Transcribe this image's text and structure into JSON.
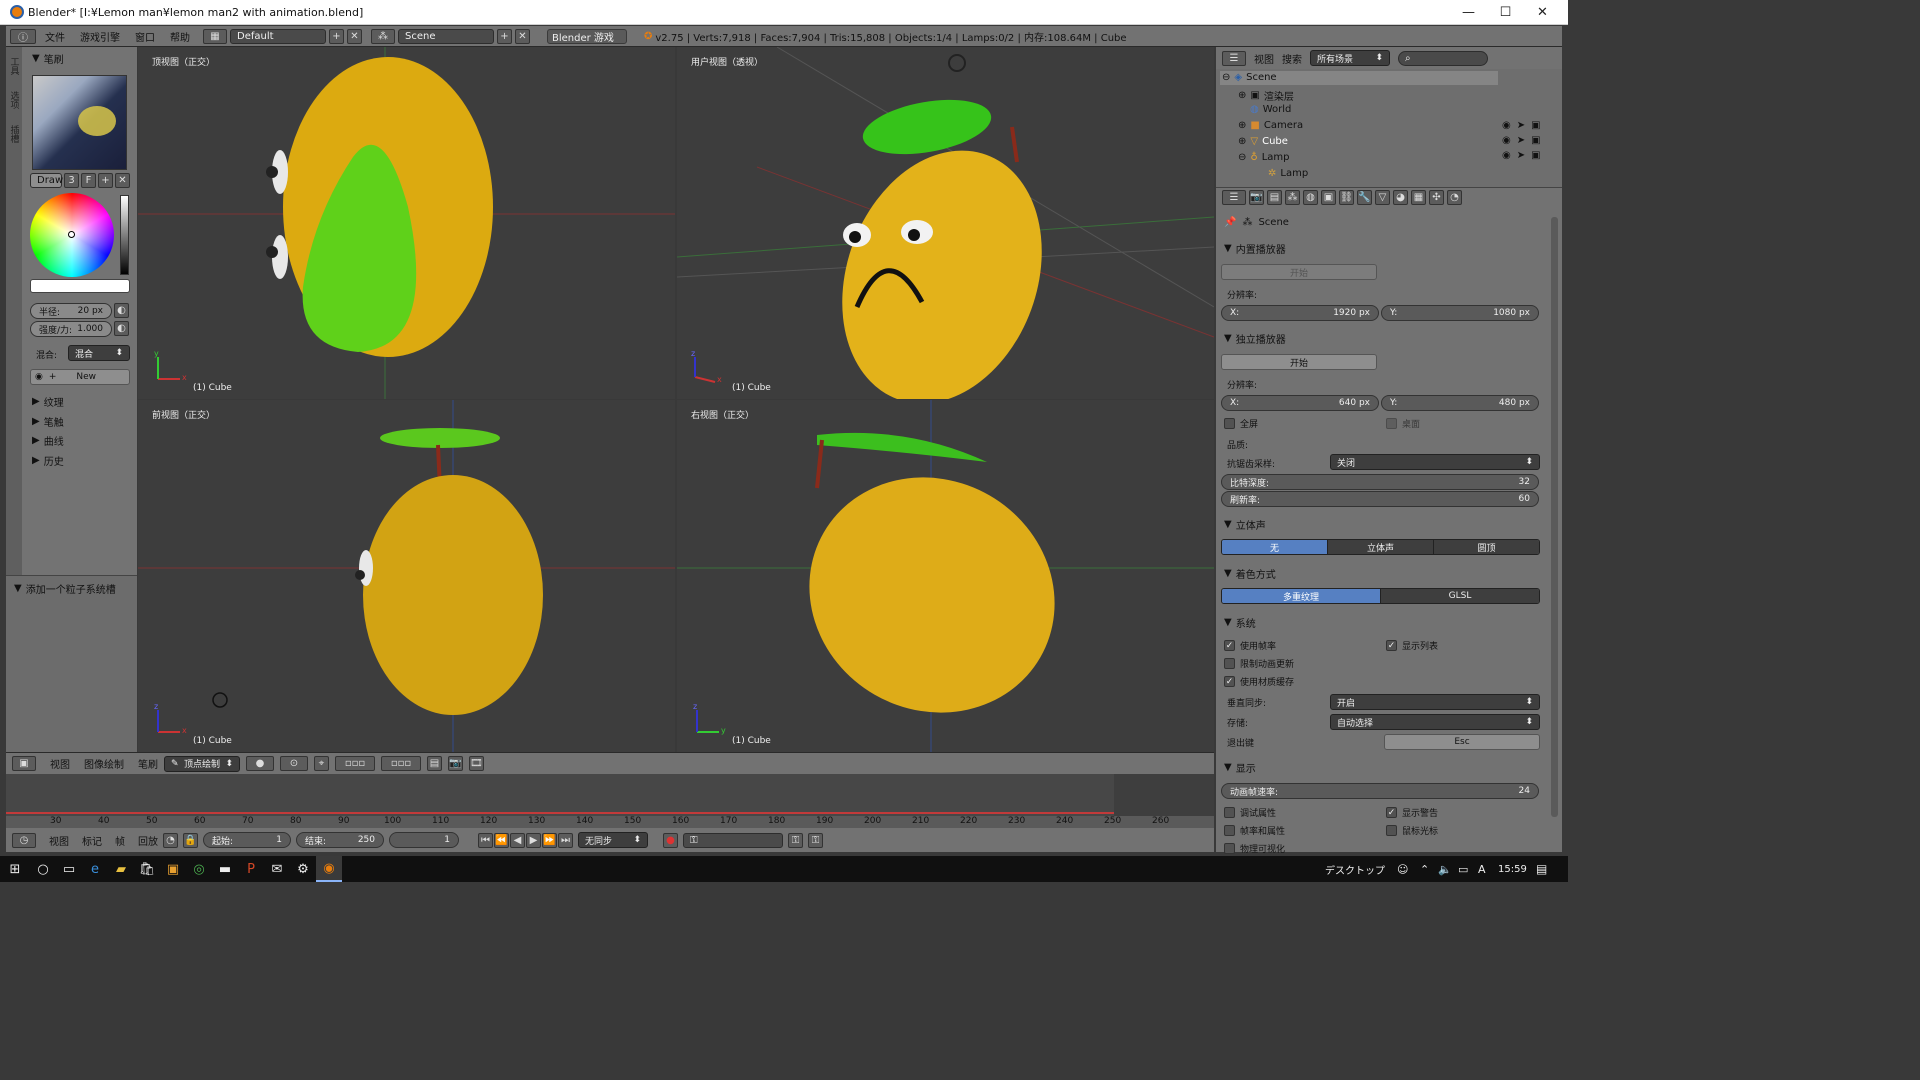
{
  "window": {
    "title": "Blender* [I:¥Lemon man¥lemon man2 with animation.blend]",
    "minimize": "—",
    "maximize": "☐",
    "close": "✕"
  },
  "menubar": {
    "items": [
      "文件",
      "游戏引擎",
      "窗口",
      "帮助"
    ],
    "layout": "Default",
    "scene": "Scene",
    "engine": "Blender 游戏",
    "stats": "v2.75 | Verts:7,918 | Faces:7,904 | Tris:15,808 | Objects:1/4 | Lamps:0/2 | 内存:108.64M | Cube"
  },
  "left_panel": {
    "tabs": [
      "工具",
      "选项",
      "插槽"
    ],
    "brush_header": "笔刷",
    "brush_name": "Draw",
    "brush_num": "3",
    "brush_f": "F",
    "radius_label": "半径:",
    "radius_value": "20 px",
    "strength_label": "强度/力:",
    "strength_value": "1.000",
    "blend_label": "混合:",
    "blend_value": "混合",
    "new_label": "New",
    "sections": [
      "纹理",
      "笔触",
      "曲线",
      "历史"
    ],
    "particle_header": "添加一个粒子系统槽"
  },
  "viewports": [
    {
      "label": "顶视图（正交）",
      "object": "(1) Cube",
      "axis_a": "x",
      "axis_b": "y"
    },
    {
      "label": "用户视图（透视）",
      "object": "(1) Cube",
      "axis_a": "x",
      "axis_b": "z"
    },
    {
      "label": "前视图（正交）",
      "object": "(1) Cube",
      "axis_a": "x",
      "axis_b": "z"
    },
    {
      "label": "右视图（正交）",
      "object": "(1) Cube",
      "axis_a": "y",
      "axis_b": "z"
    }
  ],
  "outliner": {
    "menu_view": "视图",
    "menu_search": "搜索",
    "filter": "所有场景",
    "items": [
      "Scene",
      "渲染层",
      "World",
      "Camera",
      "Cube",
      "Lamp",
      "Lamp"
    ]
  },
  "properties": {
    "context": "Scene",
    "embedded_header": "内置播放器",
    "embedded_start": "开始",
    "embedded_res_label": "分辨率:",
    "embedded_x_label": "X:",
    "embedded_x": "1920 px",
    "embedded_y_label": "Y:",
    "embedded_y": "1080 px",
    "standalone_header": "独立播放器",
    "standalone_start": "开始",
    "standalone_res_label": "分辨率:",
    "standalone_x_label": "X:",
    "standalone_x": "640 px",
    "standalone_y_label": "Y:",
    "standalone_y": "480 px",
    "fullscreen": "全屏",
    "desktop": "桌面",
    "quality_label": "品质:",
    "aa_label": "抗锯齿采样:",
    "aa_value": "关闭",
    "bit_depth_label": "比特深度:",
    "bit_depth": "32",
    "refresh_label": "刷新率:",
    "refresh": "60",
    "stereo_header": "立体声",
    "stereo_opts": [
      "无",
      "立体声",
      "圆顶"
    ],
    "shading_header": "着色方式",
    "shading_opts": [
      "多重纹理",
      "GLSL"
    ],
    "system_header": "系统",
    "use_fps": "使用帧率",
    "show_list": "显示列表",
    "limit_anim": "限制动画更新",
    "use_mat_cache": "使用材质缓存",
    "vsync_label": "垂直同步:",
    "vsync_value": "开启",
    "storage_label": "存储:",
    "storage_value": "自动选择",
    "exit_label": "退出键",
    "exit_value": "Esc",
    "display_header": "显示",
    "anim_fps_label": "动画帧速率:",
    "anim_fps": "24",
    "debug_props": "调试属性",
    "show_warnings": "显示警告",
    "framerate_profile": "帧率和属性",
    "mouse_cursor": "鼠标光标",
    "physics_vis": "物理可视化"
  },
  "view3d_header": {
    "items": [
      "视图",
      "图像绘制",
      "笔刷"
    ],
    "mode": "顶点绘制"
  },
  "timeline": {
    "ticks": [
      "30",
      "40",
      "50",
      "60",
      "70",
      "80",
      "90",
      "100",
      "110",
      "120",
      "130",
      "140",
      "150",
      "160",
      "170",
      "180",
      "190",
      "200",
      "210",
      "220",
      "230",
      "240",
      "250",
      "260"
    ],
    "menu": [
      "视图",
      "标记",
      "帧",
      "回放"
    ],
    "start_label": "起始:",
    "start": "1",
    "end_label": "结束:",
    "end": "250",
    "current": "1",
    "sync": "无同步"
  },
  "taskbar": {
    "desktop": "デスクトップ",
    "time": "15:59",
    "ime": "A"
  }
}
